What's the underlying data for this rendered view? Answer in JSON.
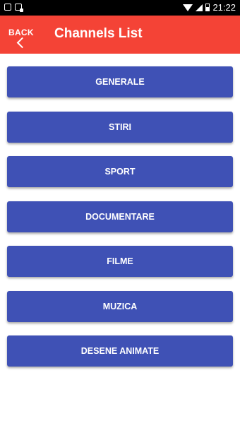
{
  "status_bar": {
    "time": "21:22",
    "icons": [
      "image-icon",
      "bag-icon",
      "wifi-icon",
      "signal-icon",
      "battery-icon"
    ]
  },
  "app_bar": {
    "back_label": "BACK",
    "title": "Channels List",
    "color": "#f44336"
  },
  "channels": [
    {
      "label": "GENERALE"
    },
    {
      "label": "STIRI"
    },
    {
      "label": "SPORT"
    },
    {
      "label": "DOCUMENTARE"
    },
    {
      "label": "FILME"
    },
    {
      "label": "MUZICA"
    },
    {
      "label": "DESENE ANIMATE"
    }
  ],
  "colors": {
    "button": "#3f51b5",
    "status_bar": "#000000",
    "background": "#ffffff"
  }
}
